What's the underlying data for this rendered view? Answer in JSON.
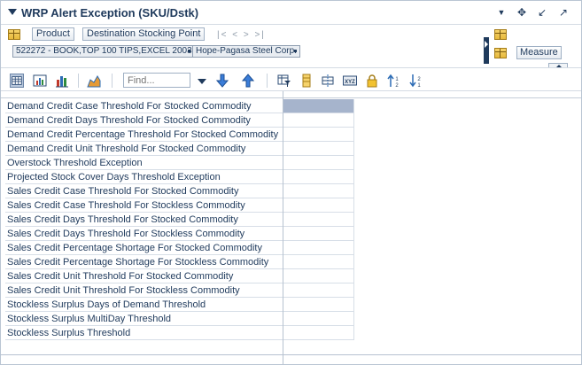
{
  "window": {
    "title": "WRP Alert Exception (SKU/Dstk)"
  },
  "header_controls": {
    "collapse_icon": "triangle-down-icon",
    "menu_icon": "dropdown-arrow-icon",
    "move_icon": "move-cross-icon",
    "minimize_icon": "arrow-down-left-icon",
    "maximize_icon": "arrow-up-right-icon",
    "menu_glyph": "▼",
    "move_glyph": "✥",
    "minimize_glyph": "↙",
    "maximize_glyph": "↗"
  },
  "dimensions": {
    "product_label": "Product",
    "destination_label": "Destination Stocking Point",
    "nav_glyphs": "|< < > >|",
    "product_value": "522272 - BOOK,TOP 100 TIPS,EXCEL 2003",
    "destination_value": "Hope-Pagasa Steel Corp.",
    "measure_label": "Measure"
  },
  "toolbar": {
    "find_placeholder": "Find...",
    "icons": [
      "grid-view-icon",
      "chart-grid-icon",
      "bar-chart-icon",
      "area-chart-icon",
      "find-dropdown-icon",
      "move-down-icon",
      "move-up-icon",
      "filter-icon",
      "highlight-icon",
      "split-icon",
      "xyz-icon",
      "lock-icon",
      "sort-ascending-icon",
      "sort-descending-icon"
    ]
  },
  "grid": {
    "rows": [
      "Demand Credit Case Threshold For Stocked Commodity",
      "Demand Credit Days Threshold For Stocked Commodity",
      "Demand Credit Percentage Threshold For Stocked Commodity",
      "Demand Credit Unit Threshold For Stocked Commodity",
      "Overstock Threshold Exception",
      "Projected Stock Cover Days Threshold Exception",
      "Sales Credit Case Threshold For Stocked Commodity",
      "Sales Credit Case Threshold For Stockless Commodity",
      "Sales Credit Days Threshold For Stocked Commodity",
      "Sales Credit Days Threshold For Stockless Commodity",
      "Sales Credit Percentage Shortage For Stocked Commodity",
      "Sales Credit Percentage Shortage For Stockless Commodity",
      "Sales Credit Unit Threshold For Stocked Commodity",
      "Sales Credit Unit Threshold For Stockless Commodity",
      "Stockless Surplus Days of Demand Threshold",
      "Stockless Surplus MultiDay Threshold",
      "Stockless Surplus Threshold"
    ],
    "selected_row_index": 0,
    "selected_color": "#a6b4cc"
  }
}
